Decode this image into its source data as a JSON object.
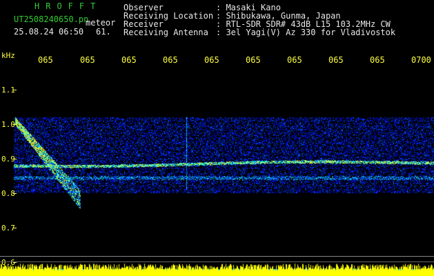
{
  "header": {
    "brand": "HROFFT",
    "file_label": "UT2508240650.pn",
    "meteor_label": "meteor",
    "date_time": "25.08.24 06:50",
    "count": "61.",
    "fields": [
      {
        "label": "Observer",
        "value": ": Masaki Kano"
      },
      {
        "label": "Receiving Location",
        "value": ": Shibukawa, Gunma, Japan"
      },
      {
        "label": "Receiver",
        "value": ": RTL-SDR SDR# 43dB L15 103.2MHz CW"
      },
      {
        "label": "Receiving Antenna",
        "value": ": 3el Yagi(V) Az 330 for Vladivostok"
      }
    ]
  },
  "axes": {
    "y_unit": "kHz",
    "y_ticks": [
      "1.1",
      "1.0",
      "0.9",
      "0.8",
      "0.7",
      "0.6"
    ],
    "x_ticks": [
      "065",
      "065",
      "065",
      "065",
      "065",
      "065",
      "065",
      "065",
      "065",
      "0700"
    ]
  },
  "colors": {
    "text_green": "#33cc33",
    "text_white": "#e8e8e8",
    "text_yellow": "#ffff44",
    "background": "#000000"
  }
}
